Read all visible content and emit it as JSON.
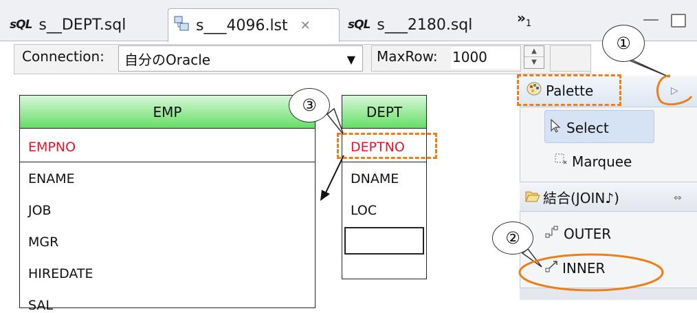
{
  "tabs": [
    {
      "label": "s__DEPT.sql",
      "icon": "sql-file-icon"
    },
    {
      "label": "s___4096.lst",
      "icon": "diagram-file-icon",
      "active": true
    },
    {
      "label": "s___2180.sql",
      "icon": "sql-file-icon"
    }
  ],
  "tab_overflow": {
    "glyph": "»",
    "count": "1"
  },
  "toolbar": {
    "connection_label": "Connection:",
    "connection_value": "自分のOracle",
    "maxrow_label": "MaxRow:",
    "maxrow_value": "1000"
  },
  "tables": {
    "emp": {
      "name": "EMP",
      "pk": "EMPNO",
      "columns": [
        "ENAME",
        "JOB",
        "MGR",
        "HIREDATE",
        "SAL"
      ]
    },
    "dept": {
      "name": "DEPT",
      "pk": "DEPTNO",
      "columns": [
        "DNAME",
        "LOC"
      ]
    }
  },
  "palette": {
    "title": "Palette",
    "tools": [
      "Select",
      "Marquee"
    ],
    "drawer_label": "結合(JOIN♪)",
    "join_items": [
      "OUTER",
      "INNER"
    ]
  },
  "annotations": {
    "c1": "①",
    "c2": "②",
    "c3": "③"
  },
  "colors": {
    "accent": "#ee7f16",
    "pk_text": "#e2142b",
    "header_green": "#66de66"
  }
}
